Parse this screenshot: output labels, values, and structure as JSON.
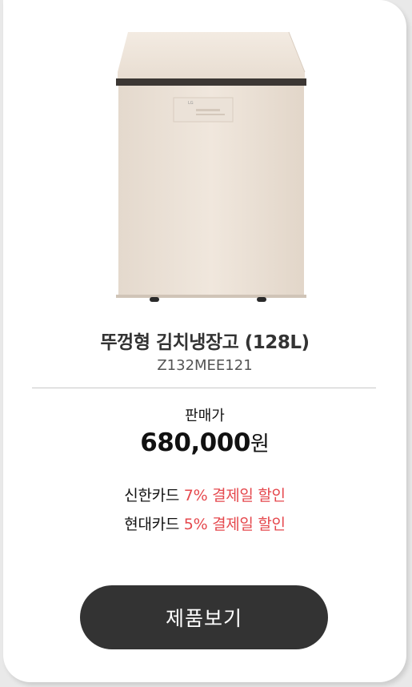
{
  "product": {
    "title": "뚜껑형 김치냉장고 (128L)",
    "model": "Z132MEE121",
    "image_icon": "kimchi-refrigerator-image"
  },
  "price": {
    "label": "판매가",
    "amount": "680,000",
    "unit": "원"
  },
  "promotions": [
    {
      "card": "신한카드",
      "discount": "7% 결제일 할인"
    },
    {
      "card": "현대카드",
      "discount": "5% 결제일 할인"
    }
  ],
  "cta": {
    "label": "제품보기"
  },
  "colors": {
    "accent": "#e5484d",
    "button_bg": "#333333",
    "appliance_body": "#ede3d8"
  }
}
